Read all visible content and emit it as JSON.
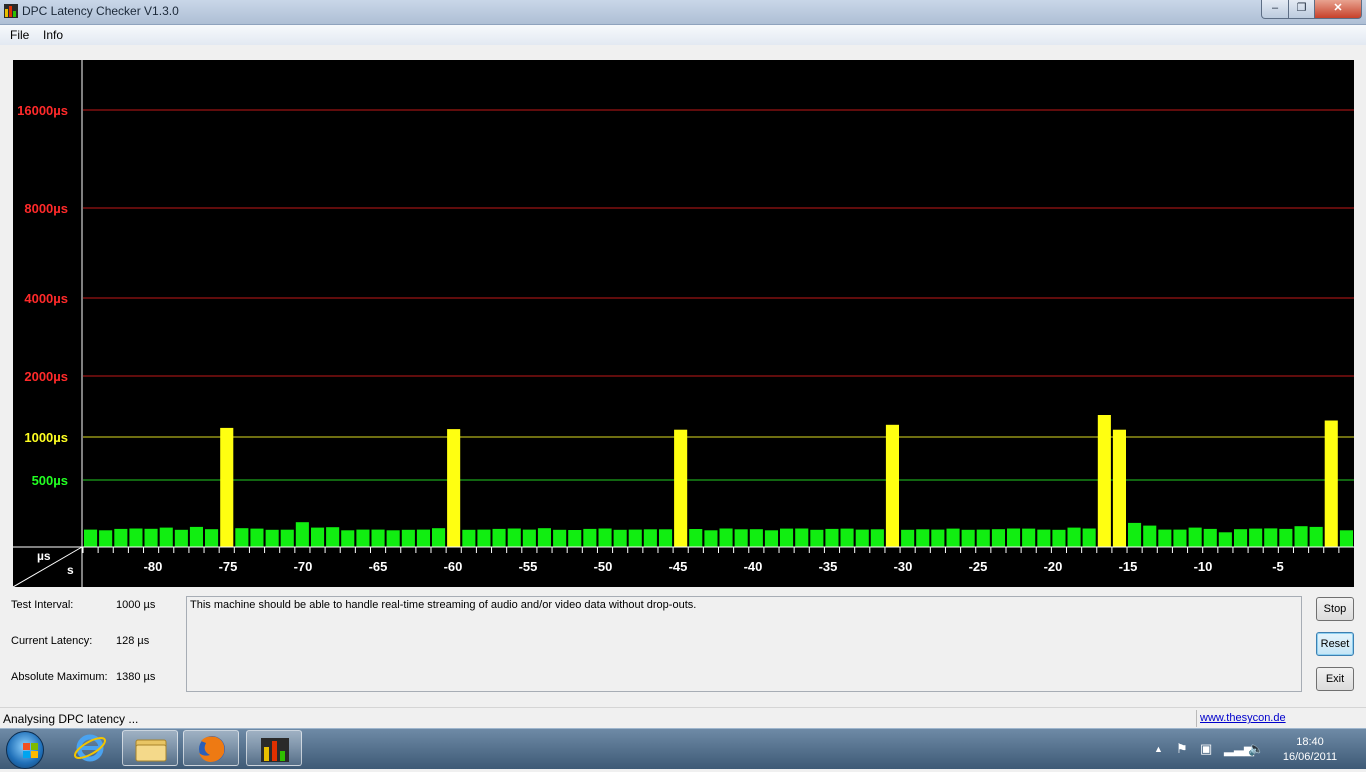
{
  "window": {
    "title": "DPC Latency Checker V1.3.0",
    "minimize": "‒",
    "maximize": "❐",
    "close": "✕"
  },
  "menu": [
    "File",
    "Info"
  ],
  "chart_data": {
    "type": "bar",
    "y_label": "µs",
    "x_label": "s",
    "y_ticks": [
      {
        "label": "16000µs",
        "value": 16000,
        "color": "#ff2a2a"
      },
      {
        "label": "8000µs",
        "value": 8000,
        "color": "#ff2a2a"
      },
      {
        "label": "4000µs",
        "value": 4000,
        "color": "#ff2a2a"
      },
      {
        "label": "2000µs",
        "value": 2000,
        "color": "#ff2a2a"
      },
      {
        "label": "1000µs",
        "value": 1000,
        "color": "#ffff22"
      },
      {
        "label": "500µs",
        "value": 500,
        "color": "#22ff22"
      }
    ],
    "x_ticks": [
      -80,
      -75,
      -70,
      -65,
      -60,
      -55,
      -50,
      -45,
      -40,
      -35,
      -30,
      -25,
      -20,
      -15,
      -10,
      -5
    ],
    "x_range": [
      -85,
      0
    ],
    "values": [
      130,
      125,
      135,
      138,
      136,
      145,
      128,
      150,
      133,
      1150,
      140,
      137,
      128,
      129,
      185,
      145,
      148,
      125,
      130,
      130,
      125,
      128,
      130,
      140,
      1130,
      128,
      130,
      135,
      138,
      130,
      140,
      128,
      127,
      135,
      138,
      128,
      130,
      132,
      132,
      1120,
      134,
      125,
      138,
      132,
      133,
      125,
      137,
      138,
      128,
      135,
      137,
      130,
      132,
      1200,
      128,
      132,
      130,
      137,
      128,
      130,
      133,
      138,
      137,
      130,
      128,
      145,
      138,
      1360,
      1120,
      180,
      160,
      130,
      130,
      145,
      135,
      110,
      133,
      137,
      139,
      135,
      155,
      150,
      1270,
      125
    ],
    "colors": {
      "background": "#000000",
      "low": "#11ee11",
      "mid": "#ffff11",
      "high": "#ff1111"
    }
  },
  "info": {
    "test_interval_label": "Test Interval:",
    "test_interval_value": "1000 µs",
    "current_latency_label": "Current Latency:",
    "current_latency_value": "128 µs",
    "absolute_max_label": "Absolute Maximum:",
    "absolute_max_value": "1380 µs"
  },
  "message": "This machine should be able to handle real-time streaming of audio and/or video data without drop-outs.",
  "buttons": {
    "stop": "Stop",
    "reset": "Reset",
    "exit": "Exit"
  },
  "status": {
    "text": "Analysing DPC latency ...",
    "link": "www.thesycon.de"
  },
  "taskbar": {
    "time": "18:40",
    "date": "16/06/2011",
    "apps": [
      "internet-explorer",
      "windows-explorer",
      "firefox",
      "dpc-latency-checker"
    ]
  }
}
